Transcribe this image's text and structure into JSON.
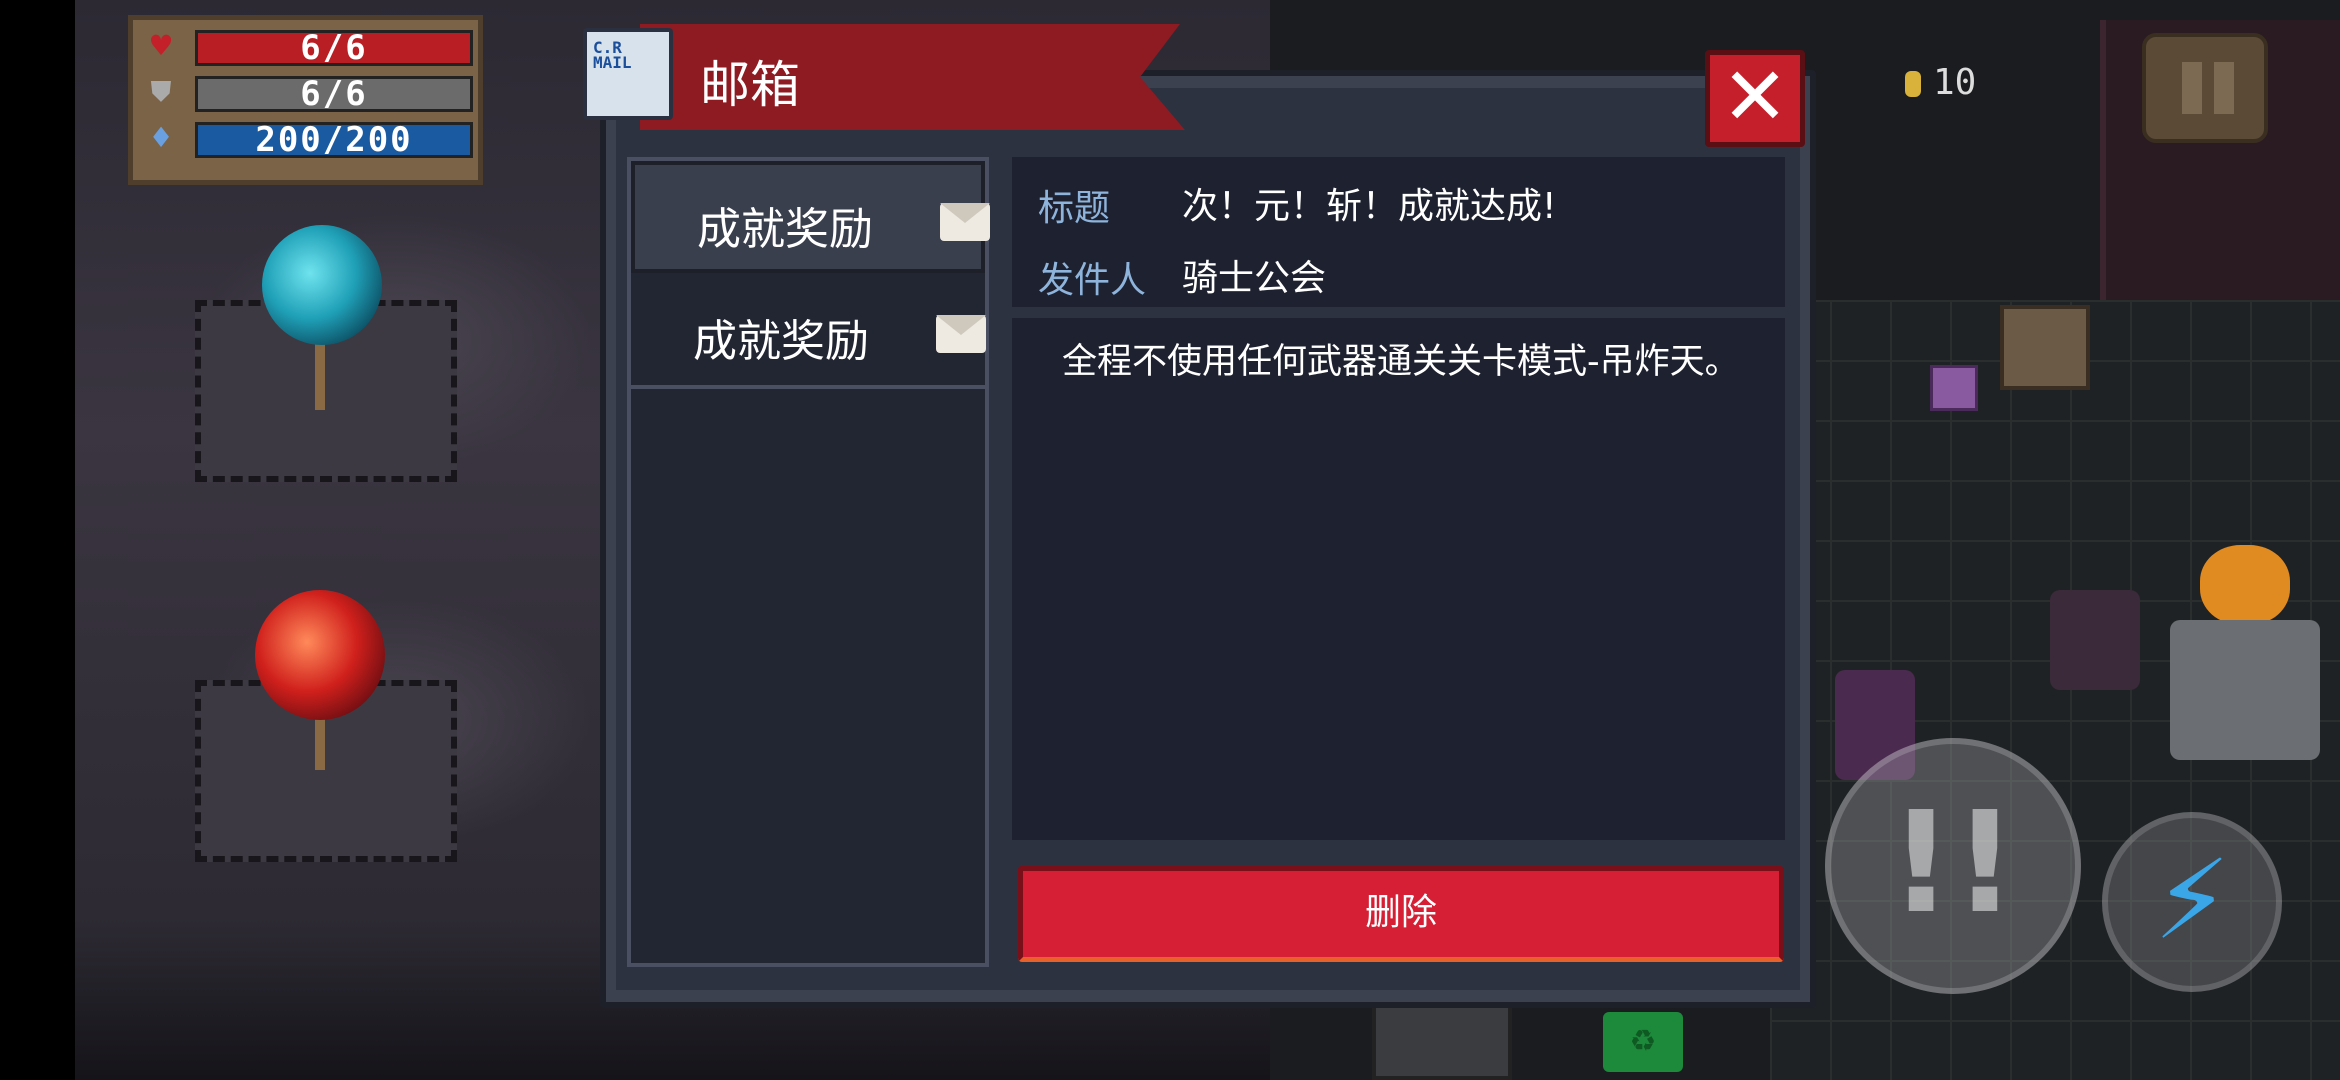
{
  "hud": {
    "hp": "6/6",
    "armor": "6/6",
    "energy": "200/200",
    "hp_icon": "heart-icon",
    "armor_icon": "shield-icon",
    "energy_icon": "energy-gem-icon",
    "colors": {
      "hp": "#b81e24",
      "armor": "#6b6b6b",
      "energy": "#1a5aa0"
    }
  },
  "coins": "10",
  "mailbox": {
    "title": "邮箱",
    "mail_icon_text": "C.R\nMAIL",
    "close_icon": "close-icon",
    "list": [
      {
        "label": "成就奖励",
        "icon": "envelope-icon",
        "selected": true
      },
      {
        "label": "成就奖励",
        "icon": "envelope-icon",
        "selected": false
      }
    ],
    "detail": {
      "subject_label": "标题",
      "subject_value": "次！元！斩！成就达成!",
      "sender_label": "发件人",
      "sender_value": "骑士公会",
      "body": "全程不使用任何武器通关关卡模式-吊炸天。"
    },
    "delete_label": "删除",
    "accent_color": "#d61f34"
  },
  "controls": {
    "pause_icon": "pause-icon",
    "skill_icon": "skill-icon",
    "lightning_icon": "lightning-icon"
  }
}
